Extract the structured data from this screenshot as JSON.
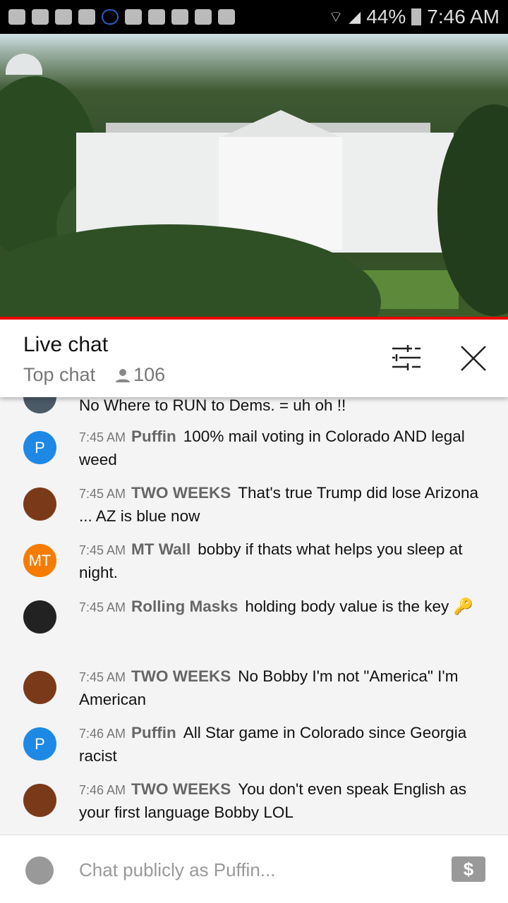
{
  "status_bar": {
    "battery": "44%",
    "time": "7:46 AM",
    "icons": [
      "youtube-icon",
      "youtube-icon",
      "crown-icon",
      "m-icon",
      "cloud-outline-icon",
      "folder-icon",
      "warning-icon",
      "image-icon",
      "cloud-icon",
      "shopping-bag-icon"
    ]
  },
  "header": {
    "title": "Live chat",
    "mode": "Top chat",
    "viewers": "106"
  },
  "chat": {
    "partial": "No Where to RUN to Dems. = uh oh !!",
    "messages": [
      {
        "time": "7:45 AM",
        "author": "Puffin",
        "text": "100% mail voting in Colorado AND legal weed",
        "avatar": "P",
        "color": "#1e88e5"
      },
      {
        "time": "7:45 AM",
        "author": "TWO WEEKS",
        "text": "That's true Trump did lose Arizona ... AZ is blue now",
        "avatar": "",
        "color": "#7a3a1a"
      },
      {
        "time": "7:45 AM",
        "author": "MT Wall",
        "text": "bobby if thats what helps you sleep at night.",
        "avatar": "MT",
        "color": "#f57c00"
      },
      {
        "time": "7:45 AM",
        "author": "Rolling Masks",
        "text": "holding body value is the key 🔑",
        "avatar": "",
        "color": "#222222"
      },
      {
        "time": "7:45 AM",
        "author": "TWO WEEKS",
        "text": "No Bobby I'm not \"America\" I'm American",
        "avatar": "",
        "color": "#7a3a1a"
      },
      {
        "time": "7:46 AM",
        "author": "Puffin",
        "text": "All Star game in Colorado since Georgia racist",
        "avatar": "P",
        "color": "#1e88e5"
      },
      {
        "time": "7:46 AM",
        "author": "TWO WEEKS",
        "text": "You don't even speak English as your first language Bobby LOL",
        "avatar": "",
        "color": "#7a3a1a"
      }
    ]
  },
  "input": {
    "placeholder": "Chat publicly as Puffin...",
    "superchat": "$"
  },
  "colors": {
    "accent": "#ee0000"
  }
}
